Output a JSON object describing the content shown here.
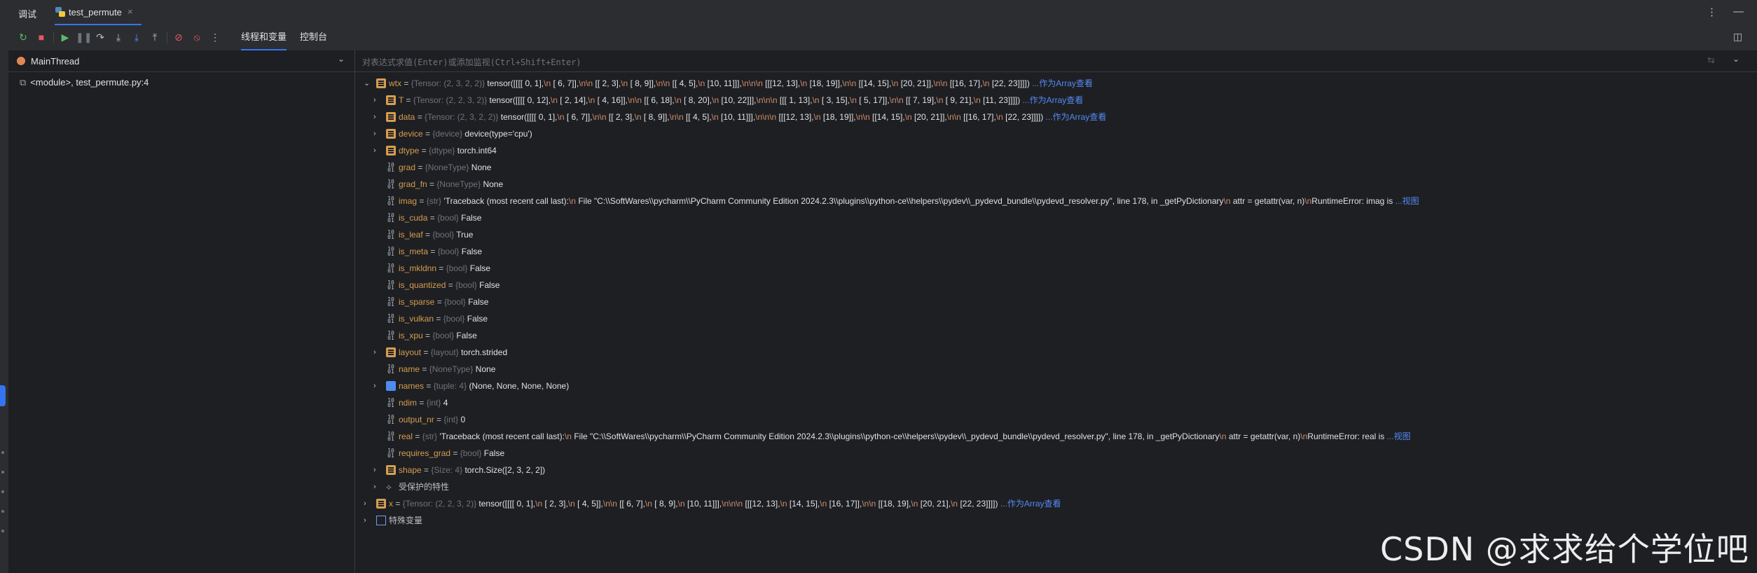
{
  "window": {
    "title": "调试",
    "tab_label": "test_permute",
    "tab_close": "×",
    "more_menu": "⋮",
    "minimize": "—"
  },
  "toolbar": {
    "tab_threads_vars": "线程和变量",
    "tab_console": "控制台"
  },
  "threads": {
    "thread_name": "MainThread",
    "frame": "<module>, test_permute.py:4"
  },
  "evaluate": {
    "placeholder": "对表达式求值(Enter)或添加监视(Ctrl+Shift+Enter)"
  },
  "variables": [
    {
      "level": 0,
      "expand": "open",
      "icon": "obj",
      "name": "wtx",
      "type": "{Tensor: (2, 3, 2, 2)}",
      "parts": [
        "tensor([[[[ 0,  1],",
        "\\n",
        "          [ 6,  7]],",
        "\\n\\n",
        "         [[ 2,  3],",
        "\\n",
        "          [ 8,  9]],",
        "\\n\\n",
        "         [[ 4,  5],",
        "\\n",
        "          [10, 11]]],",
        "\\n\\n\\n",
        "        [[[12, 13],",
        "\\n",
        "          [18, 19]],",
        "\\n\\n",
        "         [[14, 15],",
        "\\n",
        "          [20, 21]],",
        "\\n\\n",
        "         [[16, 17],",
        "\\n",
        "          [22, 23]]]])"
      ],
      "link": "...作为Array查看"
    },
    {
      "level": 1,
      "expand": "closed",
      "icon": "obj",
      "name": "T",
      "type": "{Tensor: (2, 2, 3, 2)}",
      "parts": [
        "tensor([[[[ 0, 12],",
        "\\n",
        "          [ 2, 14],",
        "\\n",
        "          [ 4, 16]],",
        "\\n\\n",
        "         [[ 6, 18],",
        "\\n",
        "          [ 8, 20],",
        "\\n",
        "          [10, 22]]],",
        "\\n\\n\\n",
        "        [[[ 1, 13],",
        "\\n",
        "          [ 3, 15],",
        "\\n",
        "          [ 5, 17]],",
        "\\n\\n",
        "         [[ 7, 19],",
        "\\n",
        "          [ 9, 21],",
        "\\n",
        "          [11, 23]]]])"
      ],
      "link": "...作为Array查看"
    },
    {
      "level": 1,
      "expand": "closed",
      "icon": "obj",
      "name": "data",
      "type": "{Tensor: (2, 3, 2, 2)}",
      "parts": [
        "tensor([[[[ 0,  1],",
        "\\n",
        "          [ 6,  7]],",
        "\\n\\n",
        "         [[ 2,  3],",
        "\\n",
        "          [ 8,  9]],",
        "\\n\\n",
        "         [[ 4,  5],",
        "\\n",
        "          [10, 11]]],",
        "\\n\\n\\n",
        "        [[[12, 13],",
        "\\n",
        "          [18, 19]],",
        "\\n\\n",
        "         [[14, 15],",
        "\\n",
        "          [20, 21]],",
        "\\n\\n",
        "         [[16, 17],",
        "\\n",
        "          [22, 23]]]])"
      ],
      "link": "...作为Array查看"
    },
    {
      "level": 1,
      "expand": "closed",
      "icon": "obj",
      "name": "device",
      "type": "{device}",
      "parts": [
        "device(type='cpu')"
      ]
    },
    {
      "level": 1,
      "expand": "closed",
      "icon": "obj",
      "name": "dtype",
      "type": "{dtype}",
      "parts": [
        "torch.int64"
      ]
    },
    {
      "level": 1,
      "expand": "none",
      "icon": "prim",
      "name": "grad",
      "type": "{NoneType}",
      "parts": [
        "None"
      ]
    },
    {
      "level": 1,
      "expand": "none",
      "icon": "prim",
      "name": "grad_fn",
      "type": "{NoneType}",
      "parts": [
        "None"
      ]
    },
    {
      "level": 1,
      "expand": "none",
      "icon": "prim",
      "name": "imag",
      "type": "{str}",
      "parts": [
        "'Traceback (most recent call last):",
        "\\n",
        "  File \"C:\\\\SoftWares\\\\pycharm\\\\PyCharm Community Edition 2024.2.3\\\\plugins\\\\python-ce\\\\helpers\\\\pydev\\\\_pydevd_bundle\\\\pydevd_resolver.py\", line 178, in _getPyDictionary",
        "\\n",
        "    attr = getattr(var, n)",
        "\\n",
        "RuntimeError: imag is "
      ],
      "link": "...视图"
    },
    {
      "level": 1,
      "expand": "none",
      "icon": "prim",
      "name": "is_cuda",
      "type": "{bool}",
      "parts": [
        "False"
      ]
    },
    {
      "level": 1,
      "expand": "none",
      "icon": "prim",
      "name": "is_leaf",
      "type": "{bool}",
      "parts": [
        "True"
      ]
    },
    {
      "level": 1,
      "expand": "none",
      "icon": "prim",
      "name": "is_meta",
      "type": "{bool}",
      "parts": [
        "False"
      ]
    },
    {
      "level": 1,
      "expand": "none",
      "icon": "prim",
      "name": "is_mkldnn",
      "type": "{bool}",
      "parts": [
        "False"
      ]
    },
    {
      "level": 1,
      "expand": "none",
      "icon": "prim",
      "name": "is_quantized",
      "type": "{bool}",
      "parts": [
        "False"
      ]
    },
    {
      "level": 1,
      "expand": "none",
      "icon": "prim",
      "name": "is_sparse",
      "type": "{bool}",
      "parts": [
        "False"
      ]
    },
    {
      "level": 1,
      "expand": "none",
      "icon": "prim",
      "name": "is_vulkan",
      "type": "{bool}",
      "parts": [
        "False"
      ]
    },
    {
      "level": 1,
      "expand": "none",
      "icon": "prim",
      "name": "is_xpu",
      "type": "{bool}",
      "parts": [
        "False"
      ]
    },
    {
      "level": 1,
      "expand": "closed",
      "icon": "obj",
      "name": "layout",
      "type": "{layout}",
      "parts": [
        "torch.strided"
      ]
    },
    {
      "level": 1,
      "expand": "none",
      "icon": "prim",
      "name": "name",
      "type": "{NoneType}",
      "parts": [
        "None"
      ]
    },
    {
      "level": 1,
      "expand": "closed",
      "icon": "list",
      "name": "names",
      "type": "{tuple: 4}",
      "parts": [
        "(None, None, None, None)"
      ]
    },
    {
      "level": 1,
      "expand": "none",
      "icon": "prim",
      "name": "ndim",
      "type": "{int}",
      "parts": [
        "4"
      ]
    },
    {
      "level": 1,
      "expand": "none",
      "icon": "prim",
      "name": "output_nr",
      "type": "{int}",
      "parts": [
        "0"
      ]
    },
    {
      "level": 1,
      "expand": "none",
      "icon": "prim",
      "name": "real",
      "type": "{str}",
      "parts": [
        "'Traceback (most recent call last):",
        "\\n",
        "  File \"C:\\\\SoftWares\\\\pycharm\\\\PyCharm Community Edition 2024.2.3\\\\plugins\\\\python-ce\\\\helpers\\\\pydev\\\\_pydevd_bundle\\\\pydevd_resolver.py\", line 178, in _getPyDictionary",
        "\\n",
        "    attr = getattr(var, n)",
        "\\n",
        "RuntimeError: real is "
      ],
      "link": "...视图"
    },
    {
      "level": 1,
      "expand": "none",
      "icon": "prim",
      "name": "requires_grad",
      "type": "{bool}",
      "parts": [
        "False"
      ]
    },
    {
      "level": 1,
      "expand": "closed",
      "icon": "obj",
      "name": "shape",
      "type": "{Size: 4}",
      "parts": [
        "torch.Size([2, 3, 2, 2])"
      ]
    },
    {
      "level": 1,
      "expand": "closed",
      "icon": "prot",
      "name": "受保护的特性",
      "plain": true
    },
    {
      "level": 0,
      "expand": "closed",
      "icon": "obj",
      "name": "x",
      "type": "{Tensor: (2, 2, 3, 2)}",
      "parts": [
        "tensor([[[[ 0,  1],",
        "\\n",
        "          [ 2,  3],",
        "\\n",
        "          [ 4,  5]],",
        "\\n\\n",
        "         [[ 6,  7],",
        "\\n",
        "          [ 8,  9],",
        "\\n",
        "          [10, 11]]],",
        "\\n\\n\\n",
        "        [[[12, 13],",
        "\\n",
        "          [14, 15],",
        "\\n",
        "          [16, 17]],",
        "\\n\\n",
        "         [[18, 19],",
        "\\n",
        "          [20, 21],",
        "\\n",
        "          [22, 23]]]])"
      ],
      "link": "...作为Array查看"
    },
    {
      "level": 0,
      "expand": "closed",
      "icon": "special",
      "name": "特殊变量",
      "plain": true
    }
  ],
  "watermark": "CSDN @求求给个学位吧",
  "colors": {
    "background": "#1e1f22",
    "panel": "#2b2d30",
    "accent": "#3574f0",
    "var_name": "#d59d52",
    "newline_escape": "#cf8e6d",
    "link": "#548af7"
  }
}
